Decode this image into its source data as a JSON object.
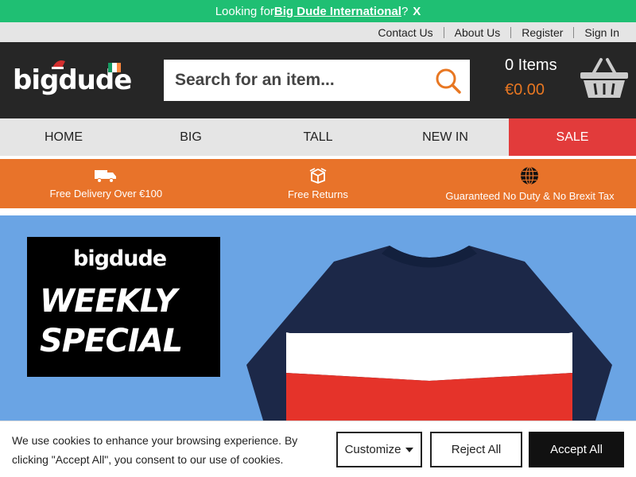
{
  "promo_bar": {
    "prefix": "Looking for ",
    "link": "Big Dude International",
    "suffix": "?",
    "close": "X"
  },
  "utility_nav": [
    "Contact Us",
    "About Us",
    "Register",
    "Sign In"
  ],
  "header": {
    "logo": "bigdude",
    "search_placeholder": "Search for an item...",
    "cart_count": "0 Items",
    "cart_total": "€0.00"
  },
  "nav": [
    "HOME",
    "BIG",
    "TALL",
    "NEW IN",
    "SALE"
  ],
  "benefits": [
    {
      "label": "Free Delivery Over €100",
      "icon": "truck-icon"
    },
    {
      "label": "Free Returns",
      "icon": "box-icon"
    },
    {
      "label": "Guaranteed No Duty & No Brexit Tax",
      "icon": "globe-icon"
    }
  ],
  "hero": {
    "brand": "bigdude",
    "line1": "WEEKLY",
    "line2": "SPECIAL"
  },
  "cookie": {
    "text": "We use cookies to enhance your browsing experience. By clicking \"Accept All\", you consent to our use of cookies.",
    "customize": "Customize",
    "reject": "Reject All",
    "accept": "Accept All"
  },
  "colors": {
    "promo": "#1fbf73",
    "header": "#262626",
    "accent": "#e87722",
    "sale": "#e23b3b",
    "hero": "#6aa4e4"
  }
}
